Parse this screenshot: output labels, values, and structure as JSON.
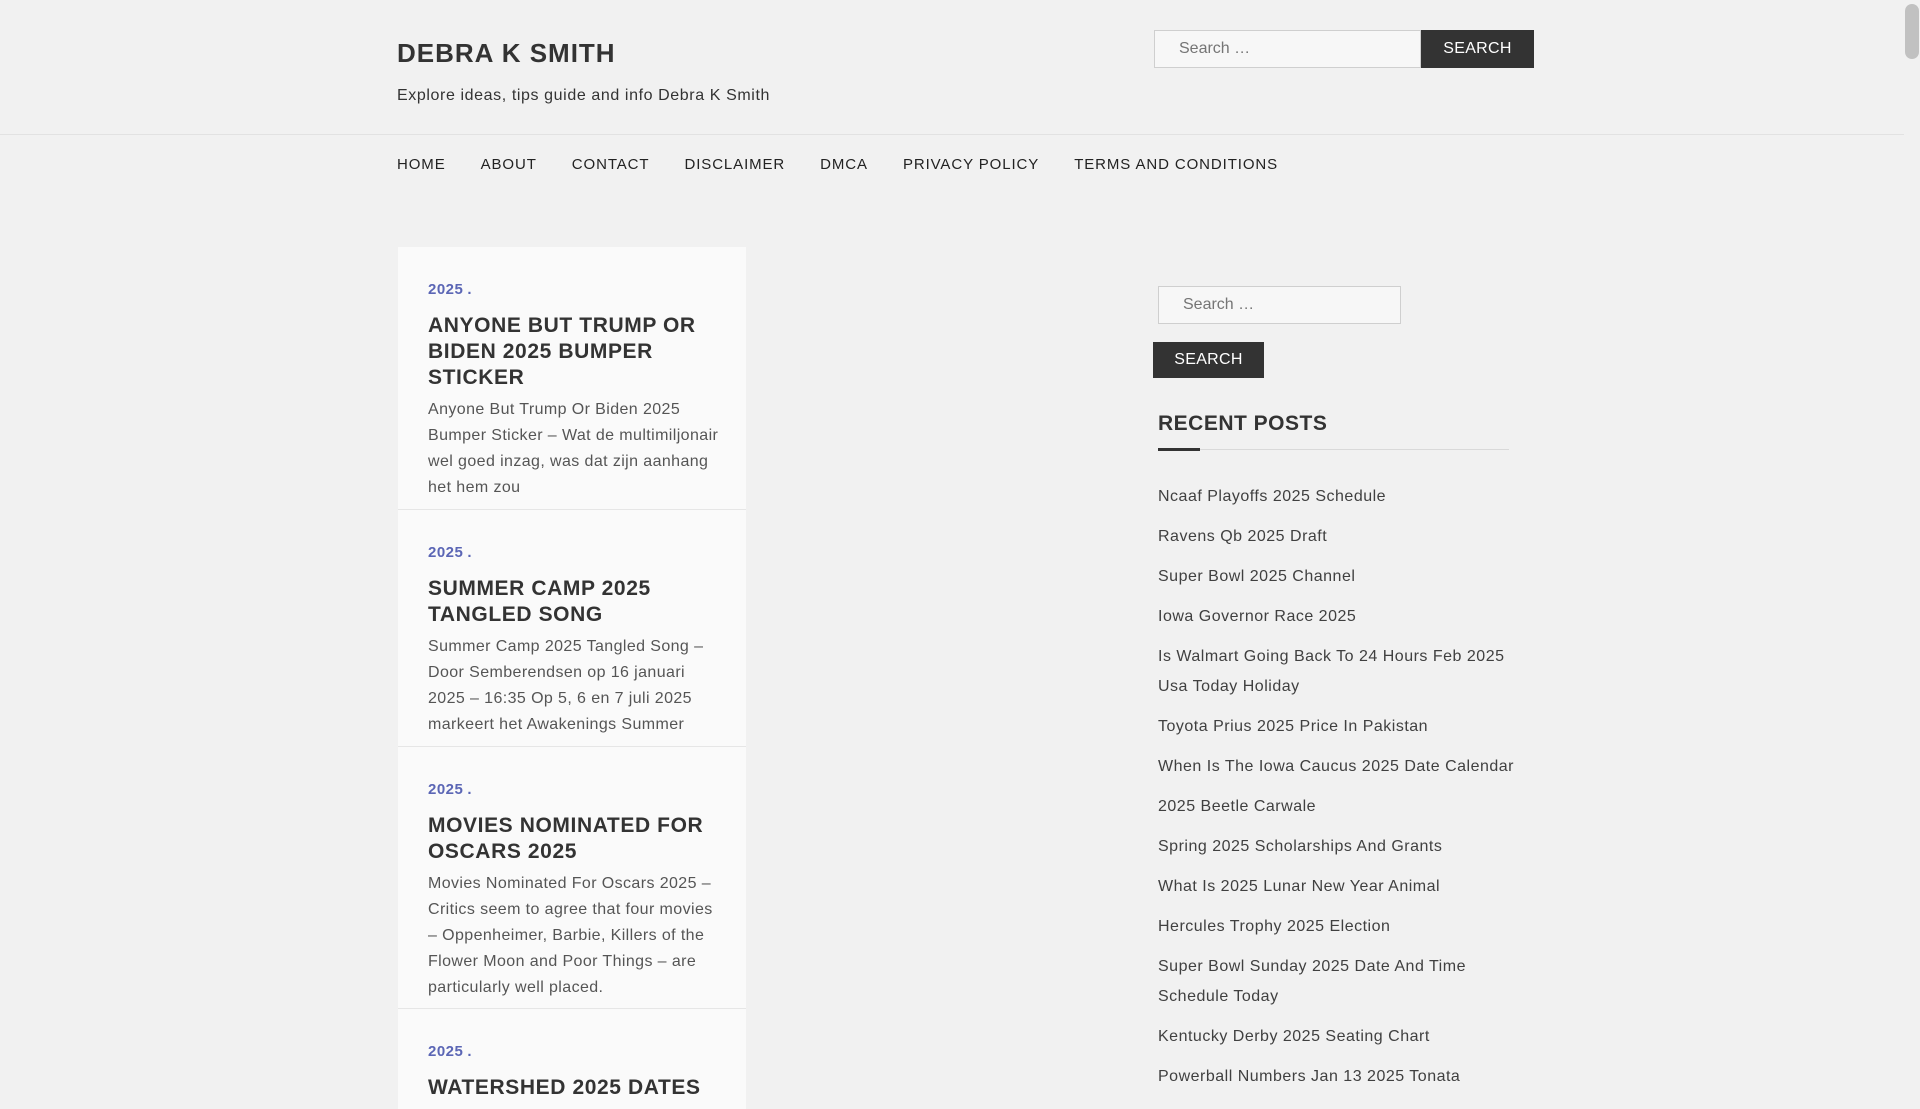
{
  "site": {
    "title": "DEBRA K SMITH",
    "description": "Explore ideas, tips guide and info Debra K Smith"
  },
  "header_search": {
    "placeholder": "Search …",
    "button": "SEARCH"
  },
  "nav": [
    "HOME",
    "ABOUT",
    "CONTACT",
    "DISCLAIMER",
    "DMCA",
    "PRIVACY POLICY",
    "TERMS AND CONDITIONS"
  ],
  "posts": [
    {
      "category": "2025",
      "separator": ".",
      "title": "ANYONE BUT TRUMP OR BIDEN 2025 BUMPER STICKER",
      "excerpt": "Anyone But Trump Or Biden 2025 Bumper Sticker – Wat de multimiljonair wel goed inzag, was dat zijn aanhang het hem zou"
    },
    {
      "category": "2025",
      "separator": ".",
      "title": "SUMMER CAMP 2025 TANGLED SONG",
      "excerpt": "Summer Camp 2025 Tangled Song – Door Semberendsen op 16 januari 2025 – 16:35 Op 5, 6 en 7 juli 2025 markeert het Awakenings Summer"
    },
    {
      "category": "2025",
      "separator": ".",
      "title": "MOVIES NOMINATED FOR OSCARS 2025",
      "excerpt": "Movies Nominated For Oscars 2025 – Critics seem to agree that four movies – Oppenheimer, Barbie, Killers of the Flower Moon and Poor Things – are particularly well placed."
    },
    {
      "category": "2025",
      "separator": ".",
      "title": "WATERSHED 2025 DATES",
      "excerpt": ""
    }
  ],
  "sidebar": {
    "search_placeholder": "Search …",
    "search_button": "SEARCH",
    "recent_title": "RECENT POSTS",
    "recent_posts": [
      "Ncaaf Playoffs 2025 Schedule",
      "Ravens Qb 2025 Draft",
      "Super Bowl 2025 Channel",
      "Iowa Governor Race 2025",
      "Is Walmart Going Back To 24 Hours Feb 2025 Usa Today Holiday",
      "Toyota Prius 2025 Price In Pakistan",
      "When Is The Iowa Caucus 2025 Date Calendar",
      "2025 Beetle Carwale",
      "Spring 2025 Scholarships And Grants",
      "What Is 2025 Lunar New Year Animal",
      "Hercules Trophy 2025 Election",
      "Super Bowl Sunday 2025 Date And Time Schedule Today",
      "Kentucky Derby 2025 Seating Chart",
      "Powerball Numbers Jan 13 2025 Tonata"
    ]
  }
}
